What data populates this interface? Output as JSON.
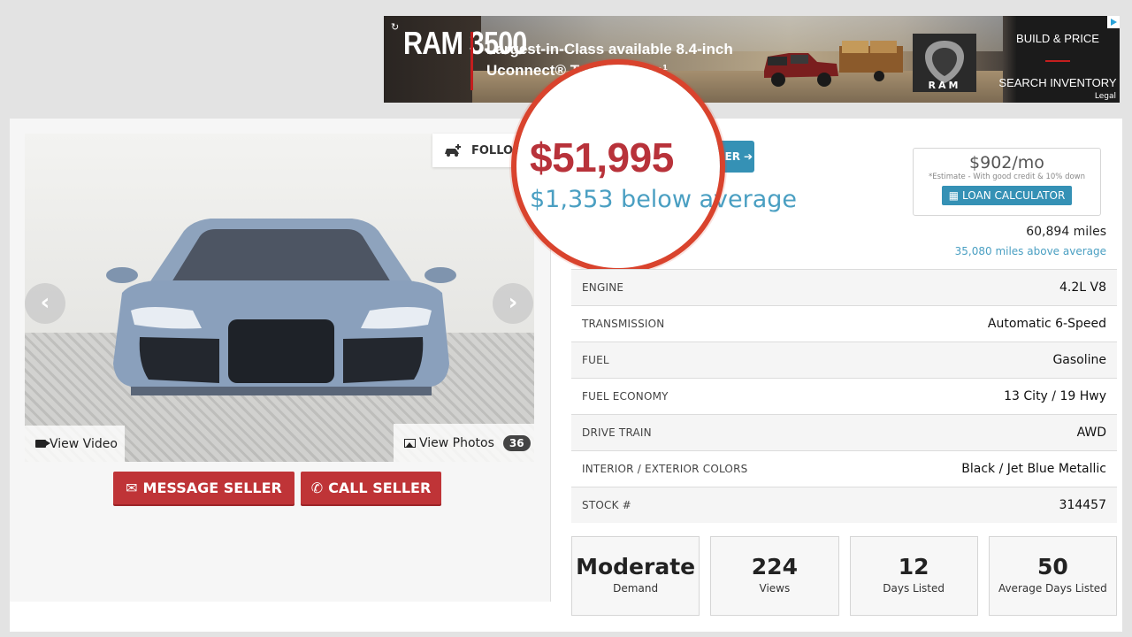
{
  "ad": {
    "model": "RAM 3500",
    "headline": "Largest-in-Class available 8.4-inch Uconnect® Touchscreen¹",
    "logo_text": "RAM",
    "cta_primary": "BUILD & PRICE",
    "cta_secondary": "SEARCH INVENTORY",
    "legal": "Legal"
  },
  "listing": {
    "follow_label": "FOLLOW",
    "price": "$51,995",
    "offer_label": "OFFER",
    "below_average": "$1,353 below average",
    "monthly": "$902/mo",
    "monthly_note": "*Estimate - With good credit & 10% down",
    "loan_calculator_label": "LOAN CALCULATOR",
    "mileage": "60,894 miles",
    "mileage_note": "35,080 miles above average"
  },
  "gallery": {
    "view_video_label": "View Video",
    "view_photos_label": "View Photos",
    "photo_count": "36"
  },
  "actions": {
    "message_seller": "MESSAGE SELLER",
    "call_seller": "CALL SELLER"
  },
  "specs": [
    {
      "label": "ENGINE",
      "value": "4.2L V8"
    },
    {
      "label": "TRANSMISSION",
      "value": "Automatic 6-Speed"
    },
    {
      "label": "FUEL",
      "value": "Gasoline"
    },
    {
      "label": "FUEL ECONOMY",
      "value": "13 City / 19 Hwy"
    },
    {
      "label": "DRIVE TRAIN",
      "value": "AWD"
    },
    {
      "label": "INTERIOR / EXTERIOR COLORS",
      "value": "Black / Jet Blue Metallic"
    },
    {
      "label": "STOCK #",
      "value": "314457"
    }
  ],
  "stats": [
    {
      "value": "Moderate",
      "label": "Demand"
    },
    {
      "value": "224",
      "label": "Views"
    },
    {
      "value": "12",
      "label": "Days Listed"
    },
    {
      "value": "50",
      "label": "Average Days Listed"
    }
  ],
  "colors": {
    "price_red": "#b8323a",
    "accent_blue": "#3591b5",
    "button_red": "#bf3437",
    "highlight_circle": "#d9432d"
  },
  "icons": [
    "refresh-icon",
    "adchoices-icon",
    "follow-car-icon",
    "chevron-left-icon",
    "chevron-right-icon",
    "video-camera-icon",
    "image-icon",
    "envelope-icon",
    "phone-icon",
    "arrow-circle-right-icon",
    "calculator-icon"
  ]
}
